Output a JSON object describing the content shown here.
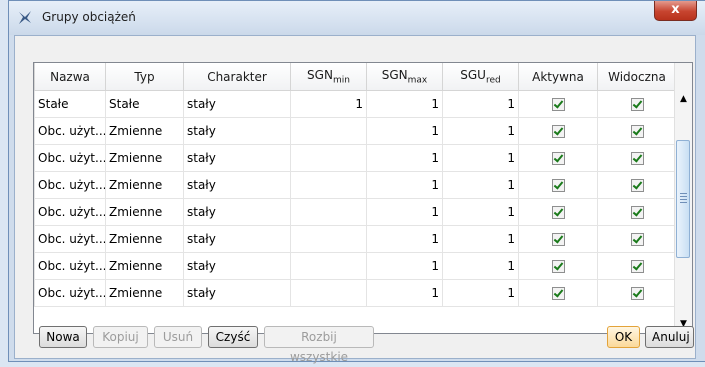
{
  "window": {
    "title": "Grupy obciążeń",
    "close_label": "x"
  },
  "table": {
    "headers": [
      {
        "text": "Nazwa"
      },
      {
        "text": "Typ"
      },
      {
        "text": "Charakter"
      },
      {
        "text": "SGN",
        "sub": "min"
      },
      {
        "text": "SGN",
        "sub": "max"
      },
      {
        "text": "SGU",
        "sub": "red"
      },
      {
        "text": "Aktywna"
      },
      {
        "text": "Widoczna"
      }
    ],
    "rows": [
      {
        "nazwa": "Stałe",
        "typ": "Stałe",
        "charakter": "stały",
        "sgn_min": "1",
        "sgn_max": "1",
        "sgu_red": "1",
        "aktywna": true,
        "widoczna": true
      },
      {
        "nazwa": "Obc. użyt...",
        "typ": "Zmienne",
        "charakter": "stały",
        "sgn_min": "",
        "sgn_max": "1",
        "sgu_red": "1",
        "aktywna": true,
        "widoczna": true
      },
      {
        "nazwa": "Obc. użyt...",
        "typ": "Zmienne",
        "charakter": "stały",
        "sgn_min": "",
        "sgn_max": "1",
        "sgu_red": "1",
        "aktywna": true,
        "widoczna": true
      },
      {
        "nazwa": "Obc. użyt...",
        "typ": "Zmienne",
        "charakter": "stały",
        "sgn_min": "",
        "sgn_max": "1",
        "sgu_red": "1",
        "aktywna": true,
        "widoczna": true
      },
      {
        "nazwa": "Obc. użyt...",
        "typ": "Zmienne",
        "charakter": "stały",
        "sgn_min": "",
        "sgn_max": "1",
        "sgu_red": "1",
        "aktywna": true,
        "widoczna": true
      },
      {
        "nazwa": "Obc. użyt...",
        "typ": "Zmienne",
        "charakter": "stały",
        "sgn_min": "",
        "sgn_max": "1",
        "sgu_red": "1",
        "aktywna": true,
        "widoczna": true
      },
      {
        "nazwa": "Obc. użyt...",
        "typ": "Zmienne",
        "charakter": "stały",
        "sgn_min": "",
        "sgn_max": "1",
        "sgu_red": "1",
        "aktywna": true,
        "widoczna": true
      },
      {
        "nazwa": "Obc. użyt...",
        "typ": "Zmienne",
        "charakter": "stały",
        "sgn_min": "",
        "sgn_max": "1",
        "sgu_red": "1",
        "aktywna": true,
        "widoczna": true
      }
    ]
  },
  "buttons": {
    "nowa": "Nowa",
    "kopiuj": "Kopiuj",
    "usun": "Usuń",
    "czysc": "Czyść",
    "rozbij": "Rozbij wszystkie",
    "ok": "OK",
    "anuluj": "Anuluj"
  },
  "icons": {
    "title": "app-icon",
    "scroll_up": "chevron-up-icon",
    "scroll_down": "chevron-down-icon",
    "checkbox": "check-icon"
  }
}
